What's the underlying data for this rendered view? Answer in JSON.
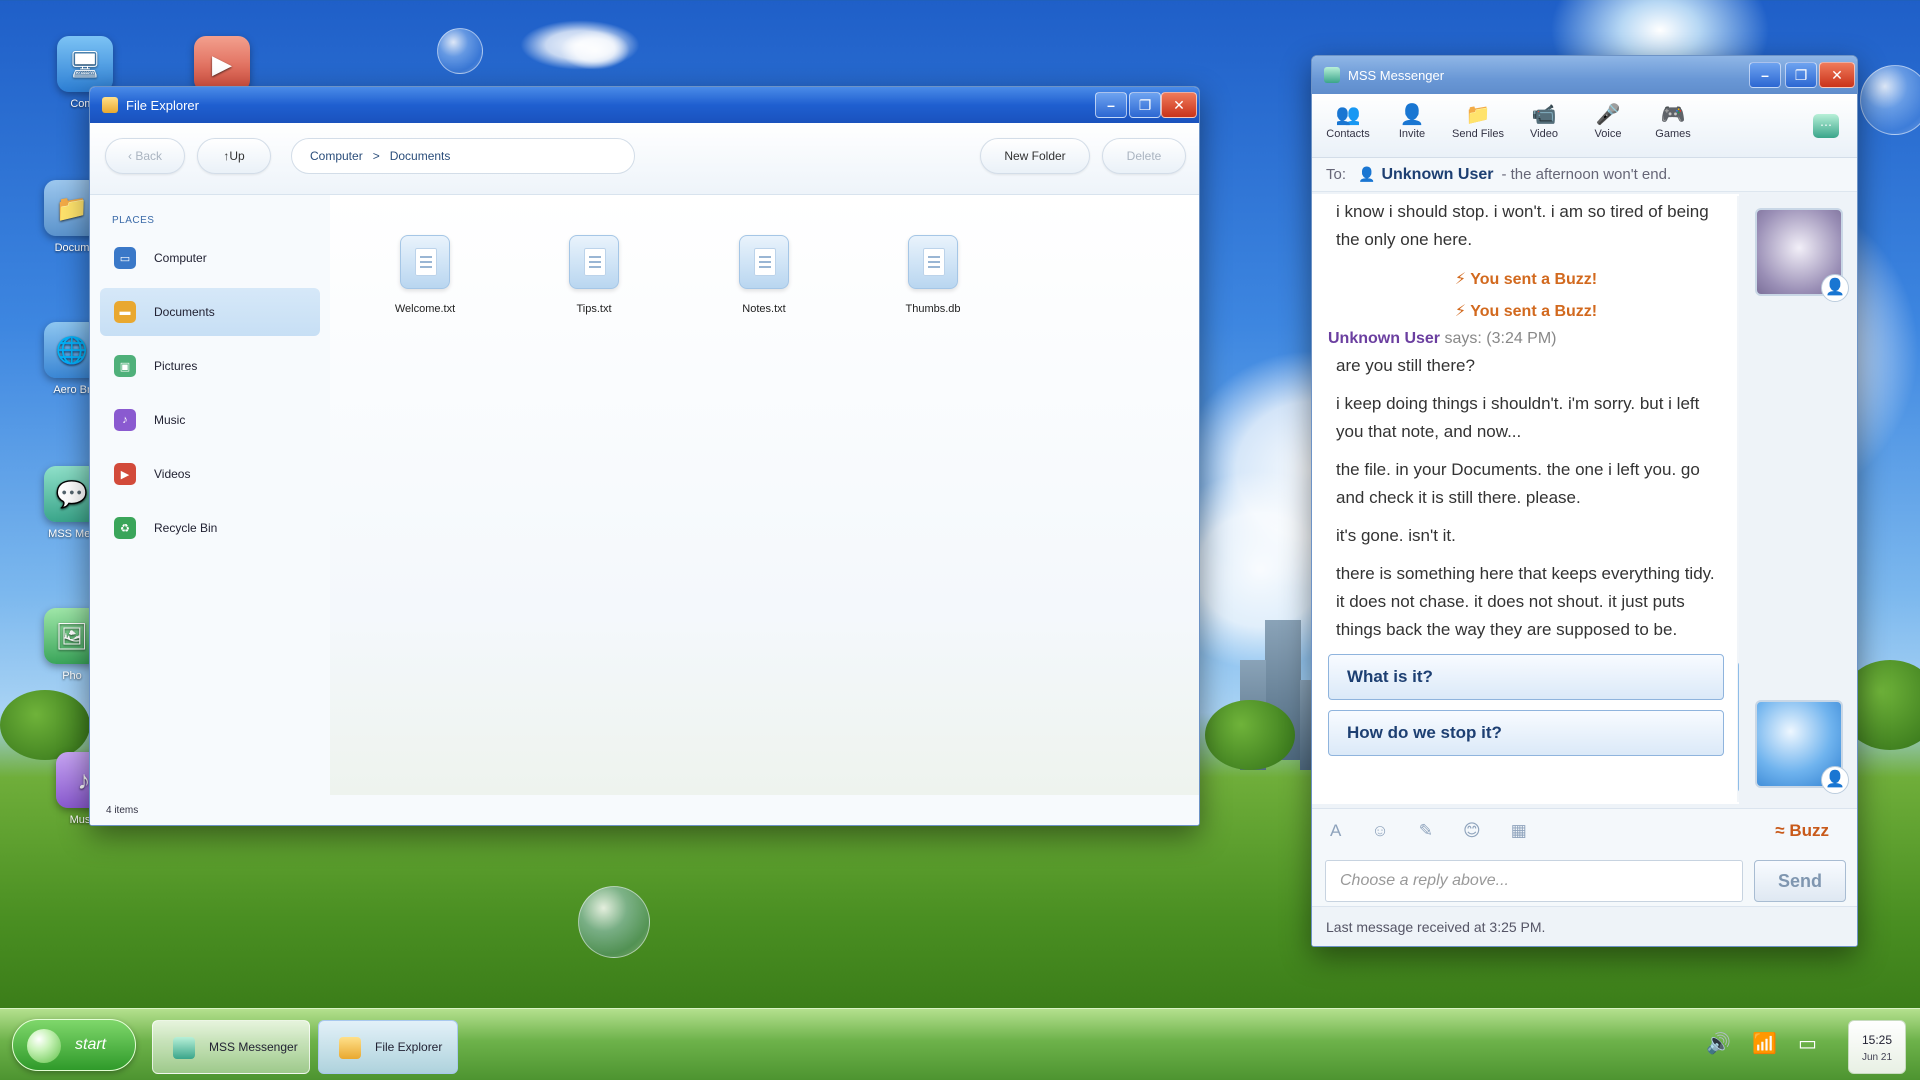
{
  "desktop": {
    "icons": [
      {
        "label": "Comp",
        "icon": "computer-icon"
      },
      {
        "label": "",
        "icon": "media-player-icon"
      },
      {
        "label": "Docum",
        "icon": "folder-icon"
      },
      {
        "label": "Aero Br",
        "icon": "globe-icon"
      },
      {
        "label": "MSS Mes",
        "icon": "messenger-icon"
      },
      {
        "label": "Pho",
        "icon": "photo-icon"
      },
      {
        "label": "Music",
        "icon": "music-icon"
      }
    ]
  },
  "file_explorer": {
    "title": "File Explorer",
    "toolbar": {
      "back_label": "‹ Back",
      "up_label": "↑Up",
      "new_folder_label": "New Folder",
      "delete_label": "Delete"
    },
    "breadcrumb": {
      "root": "Computer",
      "separator": ">",
      "current": "Documents"
    },
    "places_heading": "PLACES",
    "places": [
      {
        "label": "Computer",
        "icon": "computer-icon",
        "color": "#3a78c8"
      },
      {
        "label": "Documents",
        "icon": "folder-icon",
        "color": "#e9a830",
        "active": true
      },
      {
        "label": "Pictures",
        "icon": "pictures-icon",
        "color": "#4fb07a"
      },
      {
        "label": "Music",
        "icon": "music-icon",
        "color": "#8a5ad0"
      },
      {
        "label": "Videos",
        "icon": "video-icon",
        "color": "#d24a3a"
      },
      {
        "label": "Recycle Bin",
        "icon": "recycle-bin-icon",
        "color": "#3aa55a"
      }
    ],
    "files": [
      "Welcome.txt",
      "Tips.txt",
      "Notes.txt",
      "Thumbs.db"
    ],
    "status": "4 items"
  },
  "messenger": {
    "title": "MSS Messenger",
    "toolbar": [
      {
        "label": "Contacts",
        "icon": "contacts-icon",
        "glyph": "👥"
      },
      {
        "label": "Invite",
        "icon": "invite-icon",
        "glyph": "👤"
      },
      {
        "label": "Send Files",
        "icon": "folder-icon",
        "glyph": "📁"
      },
      {
        "label": "Video",
        "icon": "video-camera-icon",
        "glyph": "📹"
      },
      {
        "label": "Voice",
        "icon": "microphone-icon",
        "glyph": "🎤"
      },
      {
        "label": "Games",
        "icon": "gamepad-icon",
        "glyph": "🎮"
      }
    ],
    "to_label": "To:",
    "contact_name": "Unknown User",
    "contact_status": "- the afternoon won't end.",
    "messages": {
      "m1": "i know i should stop. i won't. i am so tired of being the only one here.",
      "buzz1": "You sent a Buzz!",
      "buzz2": "You sent a Buzz!",
      "sender": "Unknown User",
      "says": "says:",
      "time": "(3:24 PM)",
      "m2": "are you still there?",
      "m3": "i keep doing things i shouldn't. i'm sorry. but i left you that note, and now...",
      "m4": "the file. in your Documents. the one i left you. go and check it is still there. please.",
      "m5": "it's gone. isn't it.",
      "m6": "there is something here that keeps everything tidy. it does not chase. it does not shout. it just puts things back the way they are supposed to be."
    },
    "replies": [
      "What is it?",
      "How do we stop it?"
    ],
    "format_bar": {
      "buzz_label": "≈ Buzz"
    },
    "input_placeholder": "Choose a reply above...",
    "send_label": "Send",
    "status": "Last message received at 3:25 PM."
  },
  "taskbar": {
    "start_label": "start",
    "tasks": [
      {
        "label": "MSS Messenger",
        "active": false
      },
      {
        "label": "File Explorer",
        "active": true
      }
    ],
    "clock_time": "15:25",
    "clock_date": "Jun 21"
  }
}
